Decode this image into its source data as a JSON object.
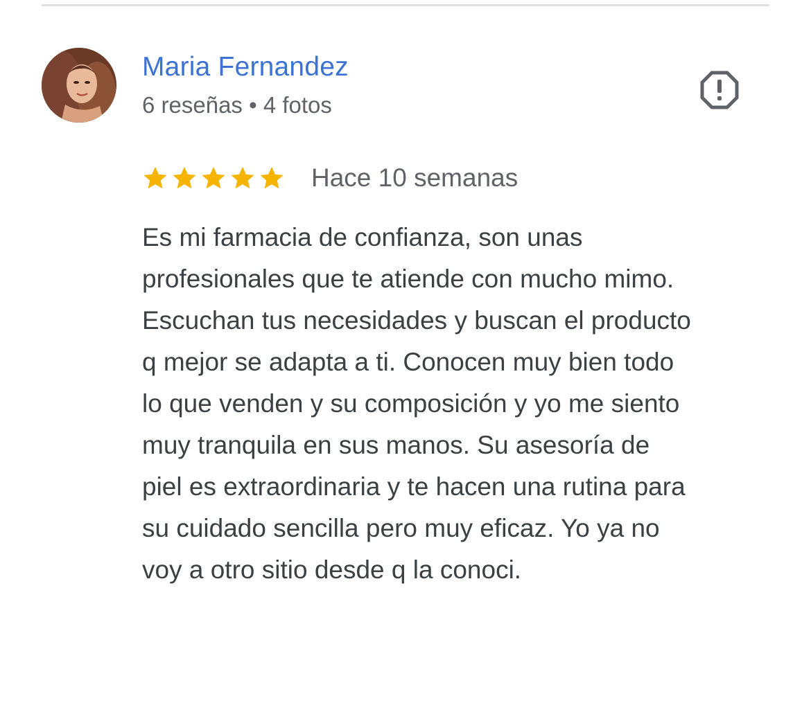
{
  "review": {
    "reviewer_name": "Maria Fernandez",
    "reviewer_meta": "6 reseñas • 4 fotos",
    "rating": 5,
    "rating_max": 5,
    "time_ago": "Hace 10 semanas",
    "text": "Es mi farmacia de confianza, son unas profesionales que te atiende con mucho mimo. Escuchan tus necesidades y buscan el producto q mejor se adapta a ti. Conocen muy bien todo lo que venden y su composición y yo me siento muy tranquila en sus manos. Su asesoría de piel es extraordinaria y te hacen una rutina para su cuidado sencilla pero muy eficaz. Yo ya no voy a otro sitio desde q la conoci."
  },
  "colors": {
    "name_link": "#3b72d4",
    "star": "#f4b400",
    "meta_text": "#5f6368",
    "body_text": "#3c4043"
  },
  "icons": {
    "report": "report-flag-icon",
    "star": "star-icon"
  }
}
